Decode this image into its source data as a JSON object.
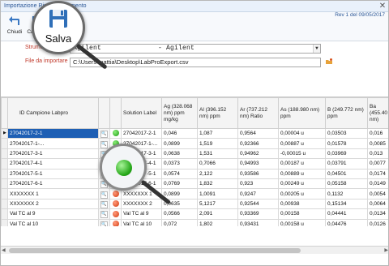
{
  "window": {
    "title": "Importazione Risultati Strumento",
    "version": "Rev 1 del 09/05/2017"
  },
  "toolbar": {
    "back_label": "Chiudi",
    "save_label": "Cancella",
    "zoom_save_label": "Salva"
  },
  "form": {
    "strumento_label": "Strumento",
    "strumento_value": "Agilent              - Agilent",
    "file_label": "File da importare",
    "file_value": "C:\\Users\\mattia\\Desktop\\LabProExport.csv"
  },
  "grid": {
    "headers": {
      "id": "ID Campione Labpro",
      "solution": "Solution Label",
      "ag": "Ag (328.068 nm) ppm mg/kg",
      "al": "Al (396.152 nm) ppm",
      "ar": "Ar (737.212 nm) Ratio",
      "as": "As (188.980 nm) ppm",
      "b": "B (249.772 nm) ppm",
      "ba": "Ba (455.40 nm)"
    },
    "rows": [
      {
        "id": "27042017-2-1",
        "status": "green",
        "solution": "27042017-2-1",
        "ag": "0,046",
        "al": "1,087",
        "ar": "0,9564",
        "as": "0,00004 u",
        "b": "0,03503",
        "ba": "0,016"
      },
      {
        "id": "27042017-1-...",
        "status": "green",
        "solution": "27042017-1-...",
        "ag": "0,0899",
        "al": "1,519",
        "ar": "0,92366",
        "as": "0,00887 u",
        "b": "0,01578",
        "ba": "0,0085"
      },
      {
        "id": "27042017-3-1",
        "status": "green",
        "solution": "27042017-3-1",
        "ag": "0,0638",
        "al": "1,531",
        "ar": "0,94962",
        "as": "-0,00015 u",
        "b": "0,03969",
        "ba": "0,013"
      },
      {
        "id": "27042017-4-1",
        "status": "green",
        "solution": "27042017-4-1",
        "ag": "0,0373",
        "al": "0,7066",
        "ar": "0,94993",
        "as": "0,00187 u",
        "b": "0,03791",
        "ba": "0,0077"
      },
      {
        "id": "27042017-5-1",
        "status": "green",
        "solution": "27042017-5-1",
        "ag": "0,0574",
        "al": "2,122",
        "ar": "0,93586",
        "as": "0,00889 u",
        "b": "0,04501",
        "ba": "0,0174"
      },
      {
        "id": "27042017-6-1",
        "status": "green",
        "solution": "27042017-6-1",
        "ag": "0,0769",
        "al": "1,832",
        "ar": "0,923",
        "as": "0,00249 u",
        "b": "0,05158",
        "ba": "0,0149"
      },
      {
        "id": "XXXXXXX 1",
        "status": "red",
        "solution": "XXXXXXX 1",
        "ag": "0,0899",
        "al": "1,0091",
        "ar": "0,9247",
        "as": "0,00205 u",
        "b": "0,1132",
        "ba": "0,0054"
      },
      {
        "id": "XXXXXXX 2",
        "status": "red",
        "solution": "XXXXXXX 2",
        "ag": "0,0635",
        "al": "5,1217",
        "ar": "0,92544",
        "as": "0,00938",
        "b": "0,15134",
        "ba": "0,0064"
      },
      {
        "id": "Val TC al 9",
        "status": "red",
        "solution": "Val TC al 9",
        "ag": "0,0566",
        "al": "2,091",
        "ar": "0,93369",
        "as": "0,00158",
        "b": "0,04441",
        "ba": "0,0134"
      },
      {
        "id": "Val TC al 10",
        "status": "red",
        "solution": "Val TC al 10",
        "ag": "0,072",
        "al": "1,802",
        "ar": "0,93431",
        "as": "0,00158 u",
        "b": "0,04476",
        "ba": "0,0126"
      }
    ]
  }
}
